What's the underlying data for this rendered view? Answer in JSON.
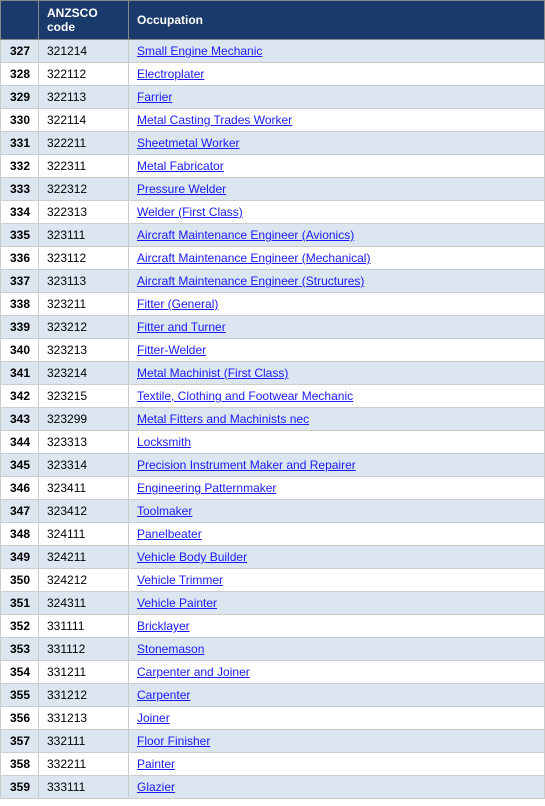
{
  "header": {
    "col1": "",
    "col2": "ANZSCO code",
    "col3": "Occupation"
  },
  "rows": [
    {
      "num": "327",
      "code": "321214",
      "occupation": "Small Engine Mechanic"
    },
    {
      "num": "328",
      "code": "322112",
      "occupation": "Electroplater"
    },
    {
      "num": "329",
      "code": "322113",
      "occupation": "Farrier"
    },
    {
      "num": "330",
      "code": "322114",
      "occupation": "Metal Casting Trades Worker"
    },
    {
      "num": "331",
      "code": "322211",
      "occupation": "Sheetmetal Worker"
    },
    {
      "num": "332",
      "code": "322311",
      "occupation": "Metal Fabricator"
    },
    {
      "num": "333",
      "code": "322312",
      "occupation": "Pressure Welder"
    },
    {
      "num": "334",
      "code": "322313",
      "occupation": "Welder (First Class)"
    },
    {
      "num": "335",
      "code": "323111",
      "occupation": "Aircraft Maintenance Engineer (Avionics)"
    },
    {
      "num": "336",
      "code": "323112",
      "occupation": "Aircraft Maintenance Engineer (Mechanical)"
    },
    {
      "num": "337",
      "code": "323113",
      "occupation": "Aircraft Maintenance Engineer (Structures)"
    },
    {
      "num": "338",
      "code": "323211",
      "occupation": "Fitter (General)"
    },
    {
      "num": "339",
      "code": "323212",
      "occupation": "Fitter and Turner"
    },
    {
      "num": "340",
      "code": "323213",
      "occupation": "Fitter-Welder"
    },
    {
      "num": "341",
      "code": "323214",
      "occupation": "Metal Machinist (First Class)"
    },
    {
      "num": "342",
      "code": "323215",
      "occupation": "Textile, Clothing and Footwear Mechanic"
    },
    {
      "num": "343",
      "code": "323299",
      "occupation": "Metal Fitters and Machinists nec"
    },
    {
      "num": "344",
      "code": "323313",
      "occupation": "Locksmith"
    },
    {
      "num": "345",
      "code": "323314",
      "occupation": "Precision Instrument Maker and Repairer"
    },
    {
      "num": "346",
      "code": "323411",
      "occupation": "Engineering Patternmaker"
    },
    {
      "num": "347",
      "code": "323412",
      "occupation": "Toolmaker"
    },
    {
      "num": "348",
      "code": "324111",
      "occupation": "Panelbeater"
    },
    {
      "num": "349",
      "code": "324211",
      "occupation": "Vehicle Body Builder"
    },
    {
      "num": "350",
      "code": "324212",
      "occupation": "Vehicle Trimmer"
    },
    {
      "num": "351",
      "code": "324311",
      "occupation": "Vehicle Painter"
    },
    {
      "num": "352",
      "code": "331111",
      "occupation": "Bricklayer"
    },
    {
      "num": "353",
      "code": "331112",
      "occupation": "Stonemason"
    },
    {
      "num": "354",
      "code": "331211",
      "occupation": "Carpenter and Joiner"
    },
    {
      "num": "355",
      "code": "331212",
      "occupation": "Carpenter"
    },
    {
      "num": "356",
      "code": "331213",
      "occupation": "Joiner"
    },
    {
      "num": "357",
      "code": "332111",
      "occupation": "Floor Finisher"
    },
    {
      "num": "358",
      "code": "332211",
      "occupation": "Painter"
    },
    {
      "num": "359",
      "code": "333111",
      "occupation": "Glazier"
    }
  ]
}
